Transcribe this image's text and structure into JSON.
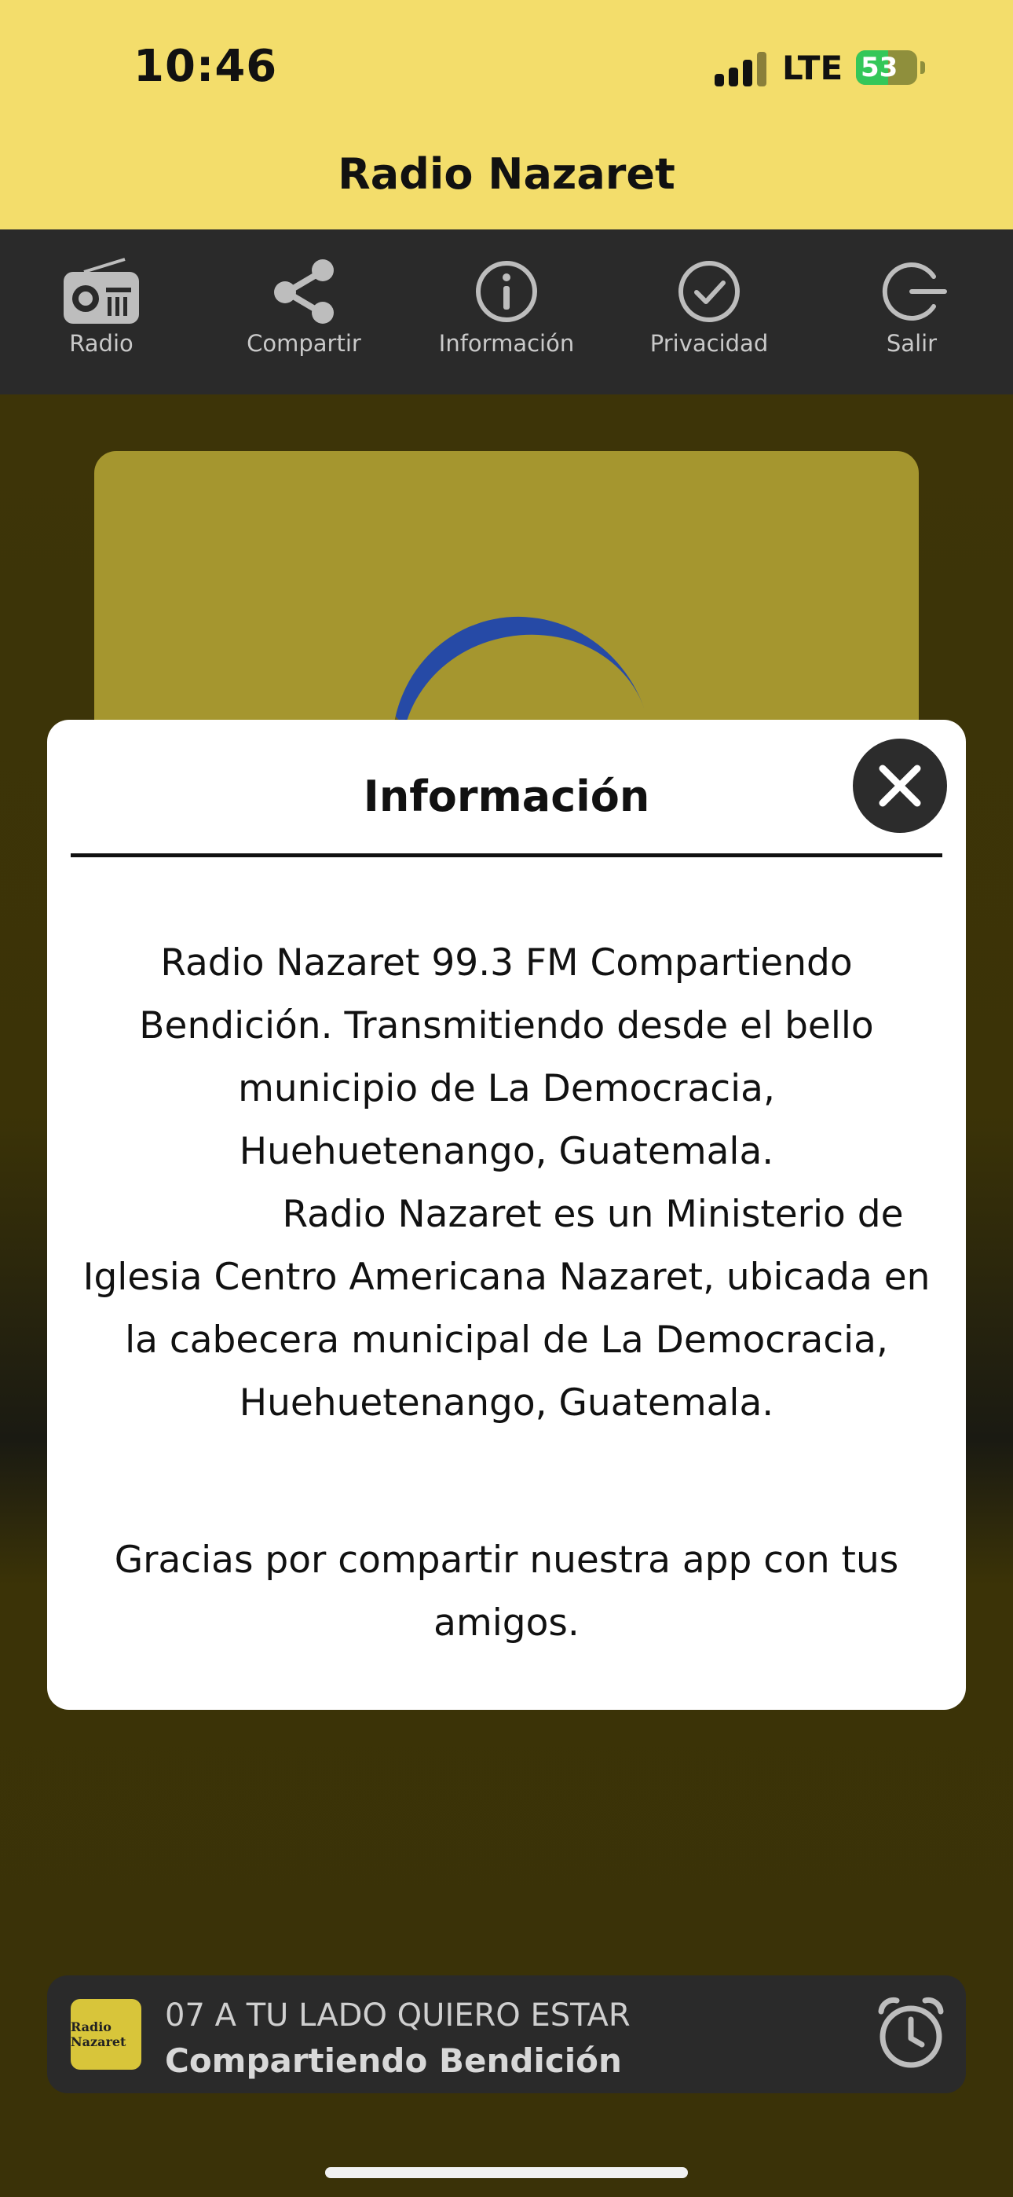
{
  "status_bar": {
    "time": "10:46",
    "network": "LTE",
    "battery": "53",
    "battery_level": 0.53
  },
  "header": {
    "title": "Radio Nazaret"
  },
  "toolbar": {
    "items": [
      {
        "label": "Radio",
        "icon": "radio-icon"
      },
      {
        "label": "Compartir",
        "icon": "share-icon"
      },
      {
        "label": "Información",
        "icon": "info-icon"
      },
      {
        "label": "Privacidad",
        "icon": "check-circle-icon"
      },
      {
        "label": "Salir",
        "icon": "exit-icon"
      }
    ]
  },
  "modal": {
    "title": "Información",
    "paragraph1": "Radio Nazaret 99.3 FM Compartiendo Bendición. Transmitiendo desde el bello municipio de La Democracia, Huehuetenango, Guatemala.",
    "paragraph2": "Radio Nazaret es un Ministerio de Iglesia Centro Americana Nazaret, ubicada en la cabecera municipal de La Democracia, Huehuetenango, Guatemala.",
    "paragraph3": "Gracias por compartir nuestra app con tus amigos."
  },
  "player": {
    "song": "07 A TU LADO QUIERO ESTAR",
    "station": "Compartiendo Bendición",
    "thumb_text": "Radio Nazaret"
  },
  "colors": {
    "header_bg": "#f3dd6b",
    "toolbar_bg": "#2a2a2a",
    "battery_green": "#34c759"
  }
}
